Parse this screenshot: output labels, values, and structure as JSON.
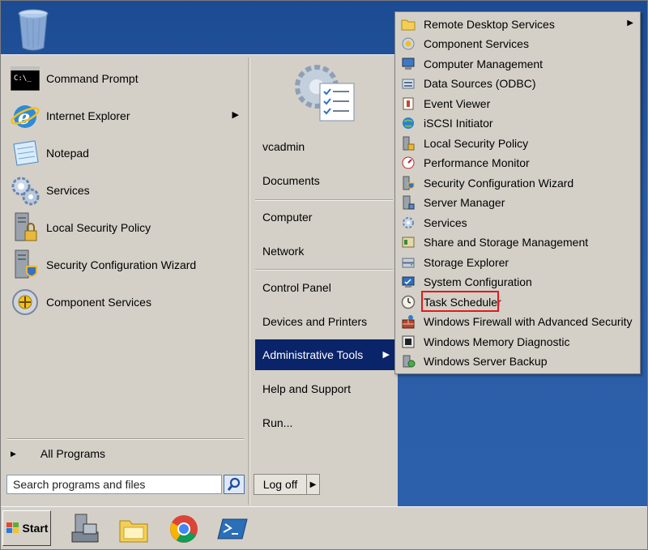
{
  "desktop": {
    "recycle_bin_icon": "recycle-bin"
  },
  "start_menu": {
    "pinned": [
      {
        "label": "Command Prompt",
        "icon": "command-prompt"
      },
      {
        "label": "Internet Explorer",
        "icon": "internet-explorer",
        "has_submenu": true
      },
      {
        "label": "Notepad",
        "icon": "notepad"
      },
      {
        "label": "Services",
        "icon": "services-gears"
      },
      {
        "label": "Local Security Policy",
        "icon": "local-security-policy"
      },
      {
        "label": "Security Configuration Wizard",
        "icon": "security-configuration-wizard"
      },
      {
        "label": "Component Services",
        "icon": "component-services"
      }
    ],
    "all_programs": "All Programs",
    "search": {
      "placeholder": "Search programs and files",
      "value": "Search programs and files"
    },
    "right": {
      "user": "vcadmin",
      "documents": "Documents",
      "computer": "Computer",
      "network": "Network",
      "control_panel": "Control Panel",
      "devices_printers": "Devices and Printers",
      "admin_tools": "Administrative Tools",
      "help": "Help and Support",
      "run": "Run..."
    },
    "logoff": "Log off",
    "colors": {
      "highlight": "#0a246a",
      "menu_bg": "#d4d0c8",
      "desktop": "#2a5ca6",
      "callout": "#e01a1a"
    }
  },
  "admin_submenu": {
    "items": [
      {
        "label": "Remote Desktop Services",
        "icon": "folder",
        "has_submenu": true
      },
      {
        "label": "Component Services",
        "icon": "component-services"
      },
      {
        "label": "Computer Management",
        "icon": "computer-management"
      },
      {
        "label": "Data Sources (ODBC)",
        "icon": "odbc"
      },
      {
        "label": "Event Viewer",
        "icon": "event-viewer"
      },
      {
        "label": "iSCSI Initiator",
        "icon": "iscsi-globe"
      },
      {
        "label": "Local Security Policy",
        "icon": "local-security-policy"
      },
      {
        "label": "Performance Monitor",
        "icon": "performance-monitor"
      },
      {
        "label": "Security Configuration Wizard",
        "icon": "security-configuration-wizard"
      },
      {
        "label": "Server Manager",
        "icon": "server-manager"
      },
      {
        "label": "Services",
        "icon": "services-gears"
      },
      {
        "label": "Share and Storage Management",
        "icon": "share-storage"
      },
      {
        "label": "Storage Explorer",
        "icon": "storage-explorer"
      },
      {
        "label": "System Configuration",
        "icon": "system-configuration"
      },
      {
        "label": "Task Scheduler",
        "icon": "clock",
        "highlighted": true
      },
      {
        "label": "Windows Firewall with Advanced Security",
        "icon": "firewall"
      },
      {
        "label": "Windows Memory Diagnostic",
        "icon": "memory-chip"
      },
      {
        "label": "Windows Server Backup",
        "icon": "server-backup"
      }
    ]
  },
  "taskbar": {
    "start_label": "Start",
    "icons": [
      "server-manager",
      "windows-explorer",
      "google-chrome",
      "powershell"
    ]
  }
}
